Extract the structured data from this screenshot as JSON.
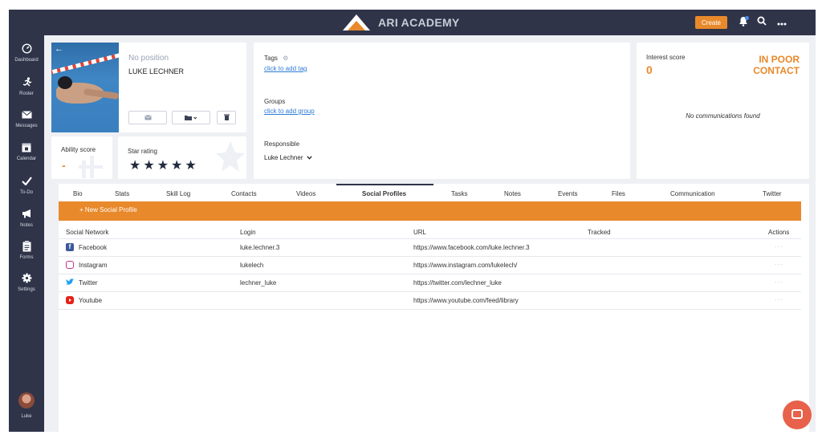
{
  "app": {
    "title": "ARI ACADEMY"
  },
  "topbar": {
    "create_label": "Create"
  },
  "sidebar": {
    "items": [
      {
        "label": "Dashboard",
        "icon": "gauge-icon"
      },
      {
        "label": "Roster",
        "icon": "runner-icon"
      },
      {
        "label": "Messages",
        "icon": "envelope-icon"
      },
      {
        "label": "Calendar",
        "icon": "calendar-icon"
      },
      {
        "label": "To-Do",
        "icon": "check-icon"
      },
      {
        "label": "Notes",
        "icon": "megaphone-icon"
      },
      {
        "label": "Forms",
        "icon": "clipboard-icon"
      },
      {
        "label": "Settings",
        "icon": "gear-icon"
      }
    ],
    "user_label": "Luke"
  },
  "profile": {
    "position": "No position",
    "name": "LUKE LECHNER"
  },
  "scores": {
    "ability_label": "Ability score",
    "ability_value": "-",
    "star_label": "Star rating",
    "star_rating": 5
  },
  "meta": {
    "tags_label": "Tags",
    "tags_link": "click to add tag",
    "groups_label": "Groups",
    "groups_link": "click to add group",
    "responsible_label": "Responsible",
    "responsible_value": "Luke Lechner"
  },
  "interest": {
    "label": "Interest score",
    "value": "0",
    "status_line1": "IN POOR",
    "status_line2": "CONTACT",
    "empty_text": "No communications found"
  },
  "tabs": [
    "Bio",
    "Stats",
    "Skill Log",
    "Contacts",
    "Videos",
    "Social Profiles",
    "Tasks",
    "Notes",
    "Events",
    "Files",
    "Communication",
    "Twitter"
  ],
  "active_tab": "Social Profiles",
  "social": {
    "new_label": "+   New Social Profile",
    "columns": [
      "Social Network",
      "Login",
      "URL",
      "Tracked",
      "Actions"
    ],
    "rows": [
      {
        "network": "Facebook",
        "login": "luke.lechner.3",
        "url": "https://www.facebook.com/luke.lechner.3",
        "color": "#3b5998"
      },
      {
        "network": "Instagram",
        "login": "lukelech",
        "url": "https://www.instagram.com/lukelech/",
        "color": "#c13584"
      },
      {
        "network": "Twitter",
        "login": "lechner_luke",
        "url": "https://twitter.com/lechner_luke",
        "color": "#1da1f2"
      },
      {
        "network": "Youtube",
        "login": "",
        "url": "https://www.youtube.com/feed/library",
        "color": "#e62117"
      }
    ],
    "actions_glyph": "···"
  }
}
